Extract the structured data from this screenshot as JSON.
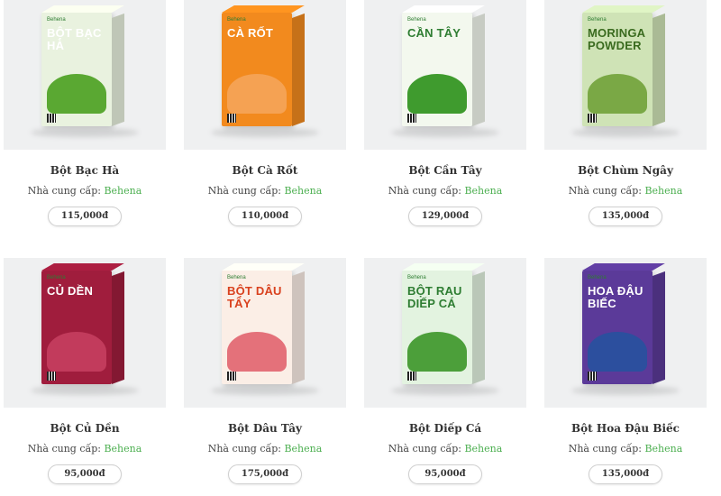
{
  "supplier_prefix": "Nhà cung cấp:",
  "products": [
    {
      "name": "Bột Bạc Hà",
      "supplier": "Behena",
      "price": "115,000đ",
      "box_label": "BỘT BẠC HÀ",
      "icon": "mint-product-image",
      "colors": {
        "box": "#e9f2df",
        "label": "#ffffff",
        "art": "#5aa832"
      }
    },
    {
      "name": "Bột Cà Rốt",
      "supplier": "Behena",
      "price": "110,000đ",
      "box_label": "CÀ RỐT",
      "icon": "carrot-product-image",
      "colors": {
        "box": "#f28a1e",
        "label": "#ffffff",
        "art": "#f5a253"
      }
    },
    {
      "name": "Bột Cần Tây",
      "supplier": "Behena",
      "price": "129,000đ",
      "box_label": "CẦN TÂY",
      "icon": "celery-product-image",
      "colors": {
        "box": "#f3f8ee",
        "label": "#2e7d32",
        "art": "#3f9b2e"
      }
    },
    {
      "name": "Bột Chùm Ngây",
      "supplier": "Behena",
      "price": "135,000đ",
      "box_label": "MORINGA POWDER",
      "icon": "moringa-product-image",
      "colors": {
        "box": "#cfe3b6",
        "label": "#3a6b1f",
        "art": "#7aa845"
      }
    },
    {
      "name": "Bột Củ Dền",
      "supplier": "Behena",
      "price": "95,000đ",
      "box_label": "CỦ DỀN",
      "icon": "beetroot-product-image",
      "colors": {
        "box": "#a01d3d",
        "label": "#ffffff",
        "art": "#c23b5c"
      }
    },
    {
      "name": "Bột Dâu Tây",
      "supplier": "Behena",
      "price": "175,000đ",
      "box_label": "BỘT DÂU TÂY",
      "icon": "strawberry-product-image",
      "colors": {
        "box": "#fbeee6",
        "label": "#d9411e",
        "art": "#e4717a"
      }
    },
    {
      "name": "Bột Diếp Cá",
      "supplier": "Behena",
      "price": "95,000đ",
      "box_label": "BỘT RAU DIẾP CÁ",
      "icon": "fish-mint-product-image",
      "colors": {
        "box": "#e3f3e0",
        "label": "#2e7d32",
        "art": "#4c9f3a"
      }
    },
    {
      "name": "Bột Hoa Đậu Biếc",
      "supplier": "Behena",
      "price": "135,000đ",
      "box_label": "HOA ĐẬU BIẾC",
      "icon": "butterfly-pea-product-image",
      "colors": {
        "box": "#5b3a99",
        "label": "#ffffff",
        "art": "#2c4f9e"
      }
    }
  ]
}
